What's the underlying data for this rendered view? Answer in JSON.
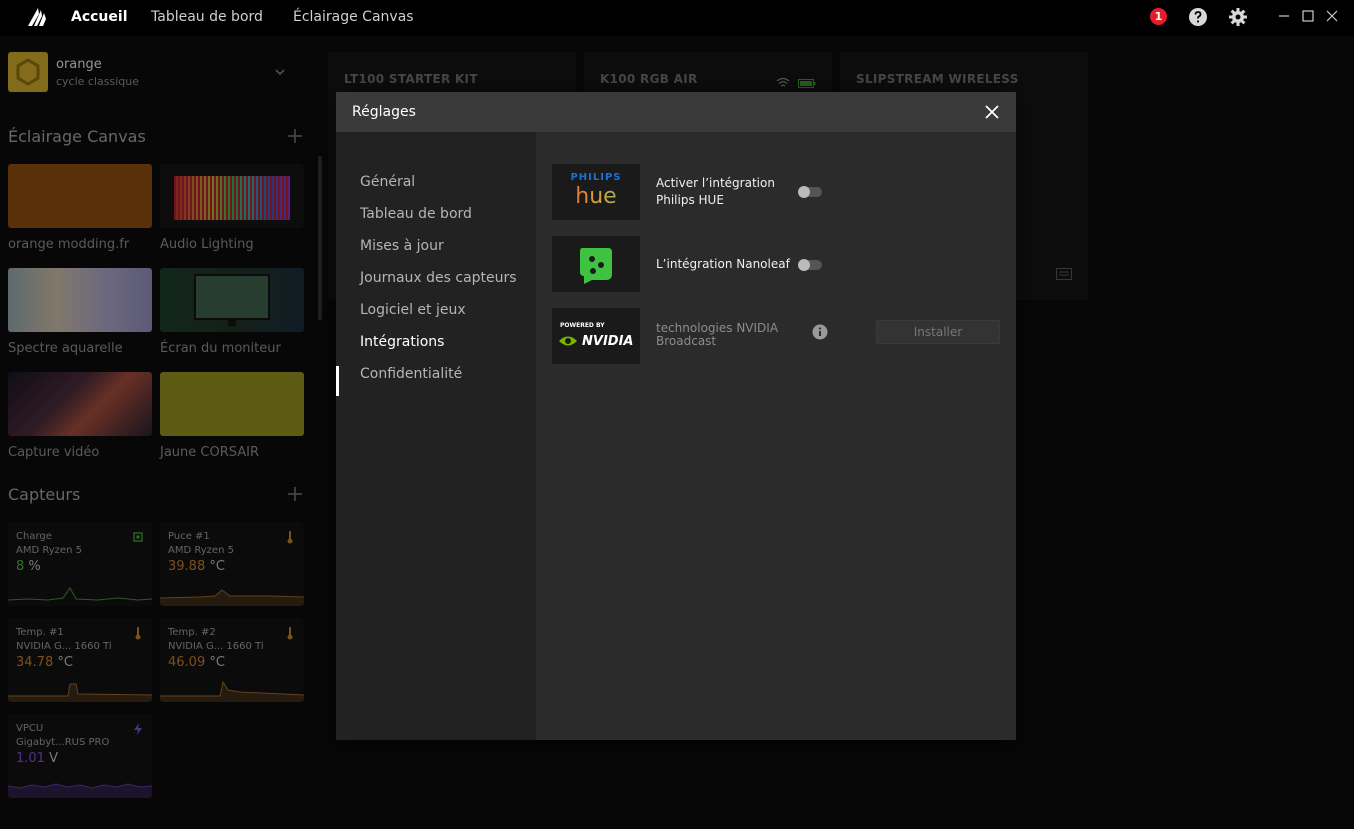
{
  "topbar": {
    "tabs": [
      {
        "label": "Accueil"
      },
      {
        "label": "Tableau de bord"
      },
      {
        "label": "Éclairage Canvas"
      }
    ],
    "notification_count": "1"
  },
  "profile": {
    "name": "orange",
    "subtitle": "cycle classique"
  },
  "canvas": {
    "title": "Éclairage Canvas",
    "tiles": [
      {
        "label": "orange modding.fr"
      },
      {
        "label": "Audio Lighting"
      },
      {
        "label": "Spectre aquarelle"
      },
      {
        "label": "Écran du moniteur"
      },
      {
        "label": "Capture vidéo"
      },
      {
        "label": "Jaune CORSAIR"
      }
    ]
  },
  "sensors": {
    "title": "Capteurs",
    "items": [
      {
        "name": "Charge",
        "device": "AMD Ryzen 5",
        "value": "8",
        "unit": "%",
        "color": "#4caf3c"
      },
      {
        "name": "Puce #1",
        "device": "AMD Ryzen 5",
        "value": "39.88",
        "unit": "°C",
        "color": "#c07a2e"
      },
      {
        "name": "Temp. #1",
        "device": "NVIDIA G... 1660 Ti",
        "value": "34.78",
        "unit": "°C",
        "color": "#c07a2e"
      },
      {
        "name": "Temp. #2",
        "device": "NVIDIA G... 1660 Ti",
        "value": "46.09",
        "unit": "°C",
        "color": "#c07a2e"
      },
      {
        "name": "VPCU",
        "device": "Gigabyt...RUS PRO",
        "value": "1.01",
        "unit": "V",
        "color": "#7b4fd6"
      }
    ]
  },
  "devices": [
    {
      "name": "LT100 STARTER KIT"
    },
    {
      "name": "K100 RGB AIR"
    },
    {
      "name": "SLIPSTREAM WIRELESS"
    }
  ],
  "modal": {
    "title": "Réglages",
    "nav": [
      {
        "label": "Général"
      },
      {
        "label": "Tableau de bord"
      },
      {
        "label": "Mises à jour"
      },
      {
        "label": "Journaux des capteurs"
      },
      {
        "label": "Logiciel et jeux"
      },
      {
        "label": "Intégrations"
      },
      {
        "label": "Confidentialité"
      }
    ],
    "integrations": {
      "hue": {
        "label_line1": "Activer l’intégration",
        "label_line2": "Philips HUE",
        "logo_top": "PHILIPS",
        "logo_bottom": "hue"
      },
      "nanoleaf": {
        "label": "L’intégration Nanoleaf"
      },
      "nvidia": {
        "label_line1": "technologies NVIDIA",
        "label_line2": "Broadcast",
        "logo_top": "POWERED BY",
        "logo_bottom": "NVIDIA",
        "button": "Installer"
      }
    }
  }
}
